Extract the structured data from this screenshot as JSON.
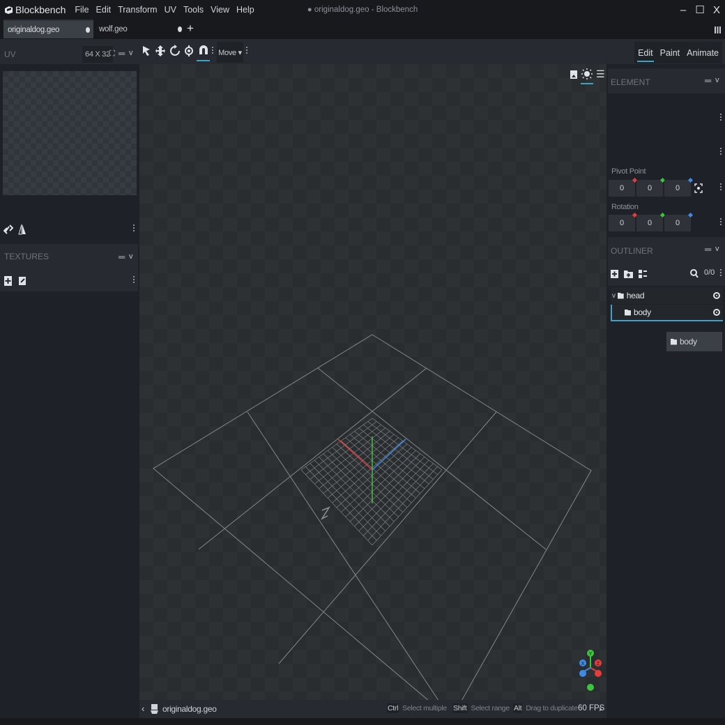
{
  "app": {
    "name": "Blockbench",
    "window_title": "● originaldog.geo - Blockbench",
    "menu": [
      "File",
      "Edit",
      "Transform",
      "UV",
      "Tools",
      "View",
      "Help"
    ],
    "window_controls": [
      "–",
      "☐",
      "X"
    ]
  },
  "tabs": [
    {
      "label": "originaldog.geo",
      "active": true
    },
    {
      "label": "wolf.geo",
      "active": false
    }
  ],
  "toolbar": {
    "tool_icons": [
      "move-tool-icon",
      "resize-tool-icon",
      "rotate-tool-icon",
      "pivot-tool-icon",
      "vertex-snap-icon"
    ],
    "transform_mode": "Move ▾"
  },
  "modes": [
    "Edit",
    "Paint",
    "Animate"
  ],
  "active_mode": "Edit",
  "uv_panel": {
    "title": "UV",
    "size": "64 X 32"
  },
  "textures_panel": {
    "title": "TEXTURES"
  },
  "element_panel": {
    "title": "ELEMENT",
    "pivot_label": "Pivot Point",
    "pivot": [
      "0",
      "0",
      "0"
    ],
    "rotation_label": "Rotation",
    "rotation": [
      "0",
      "0",
      "0"
    ],
    "axis_colors": [
      "#e63c3c",
      "#3cc43c",
      "#3c8ce6"
    ]
  },
  "outliner": {
    "title": "OUTLINER",
    "count": "0/0",
    "items": [
      {
        "label": "head",
        "type": "group",
        "expanded": true
      },
      {
        "label": "body",
        "type": "group",
        "selected": true
      }
    ],
    "drag_label": "body"
  },
  "status": {
    "project": "originaldog.geo",
    "hints": [
      {
        "key": "Ctrl",
        "text": "Select multiple"
      },
      {
        "key": "Shift",
        "text": "Select range"
      },
      {
        "key": "Alt",
        "text": "Drag to duplicate"
      }
    ],
    "fps": "60 FPS"
  },
  "gizmo": {
    "labels": [
      "Y",
      "X",
      "Z"
    ],
    "colors": {
      "x": "#e63c3c",
      "y": "#3cc43c",
      "z": "#3c8ce6"
    }
  },
  "accent": "#3fa3c8"
}
